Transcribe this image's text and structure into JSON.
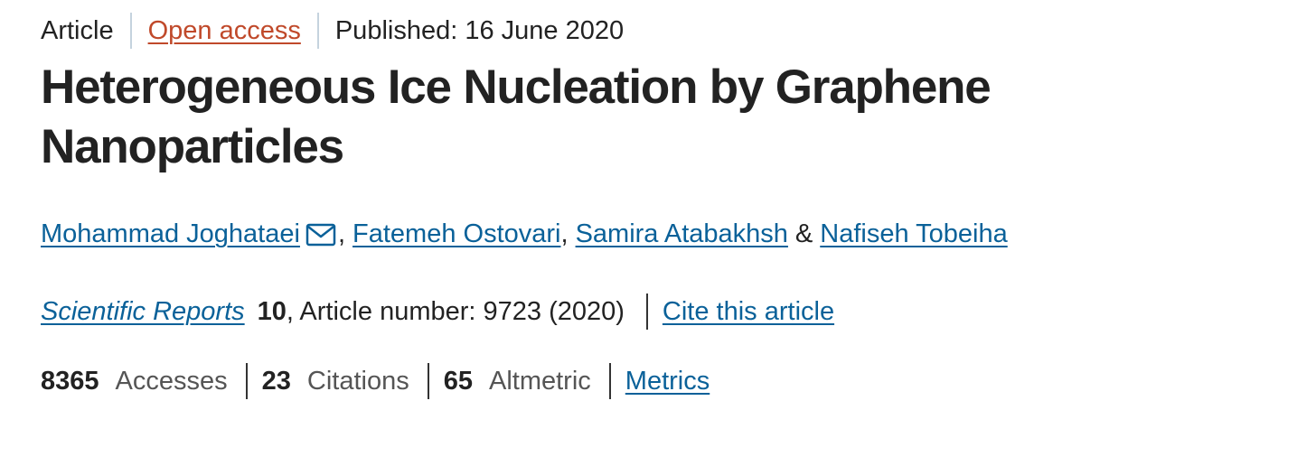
{
  "header": {
    "article_type": "Article",
    "access_label": "Open access",
    "published": "Published: 16 June 2020"
  },
  "title": {
    "line1": "Heterogeneous Ice Nucleation by Graphene",
    "line2": "Nanoparticles"
  },
  "authors": {
    "list": [
      "Mohammad Joghataei",
      "Fatemeh Ostovari",
      "Samira Atabakhsh",
      "Nafiseh Tobeiha"
    ],
    "sep_comma": ",",
    "sep_and": "&",
    "contact_icon": "envelope-icon"
  },
  "citation": {
    "journal": "Scientific Reports",
    "volume": "10",
    "details": ", Article number: 9723 (2020)",
    "cite_label": "Cite this article"
  },
  "metrics": {
    "accesses_count": "8365",
    "accesses_label": "Accesses",
    "citations_count": "23",
    "citations_label": "Citations",
    "altmetric_count": "65",
    "altmetric_label": "Altmetric",
    "metrics_link": "Metrics"
  },
  "colors": {
    "link": "#0a6199",
    "open_access": "#c0492a",
    "text": "#222222",
    "muted": "#555555"
  }
}
